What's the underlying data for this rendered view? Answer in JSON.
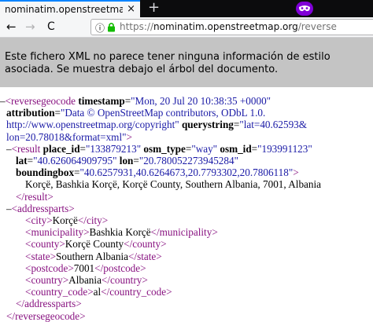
{
  "browser": {
    "tab_title": "nominatim.openstreetmap.org/revers",
    "close_glyph": "×",
    "newtab_glyph": "+",
    "back_glyph": "←",
    "forward_glyph": "→",
    "reload_glyph": "C",
    "info_glyph": "ⓘ",
    "url_scheme": "https://",
    "url_host": "nominatim.openstreetmap.org",
    "url_path": "/reverse"
  },
  "banner": {
    "message": "Este fichero XML no parece tener ninguna información de estilo asociada. Se muestra debajo el árbol del documento."
  },
  "xml": {
    "collapse": "–",
    "lt": "<",
    "gt": ">",
    "close_open": "</",
    "eq": "=",
    "root_tag": "reversegeocode",
    "attr_timestamp": "timestamp",
    "val_timestamp": "\"Mon, 20 Jul 20 10:38:35 +0000\"",
    "attr_attribution": "attribution",
    "val_attribution_1": "\"Data © OpenStreetMap contributors, ODbL 1.0.",
    "val_attribution_2": "http://www.openstreetmap.org/copyright\"",
    "attr_querystring": "querystring",
    "val_querystring_1": "\"lat=40.62593&",
    "val_querystring_2": "lon=20.78018&format=xml\"",
    "result_tag": "result",
    "attr_place_id": "place_id",
    "val_place_id": "\"133879213\"",
    "attr_osm_type": "osm_type",
    "val_osm_type": "\"way\"",
    "attr_osm_id": "osm_id",
    "val_osm_id": "\"193991123\"",
    "attr_lat": "lat",
    "val_lat": "\"40.626064909795\"",
    "attr_lon": "lon",
    "val_lon": "\"20.780052273945284\"",
    "attr_boundingbox": "boundingbox",
    "val_boundingbox": "\"40.6257931,40.6264673,20.7793302,20.7806118\"",
    "result_text": "Korçë, Bashkia Korçë, Korçë County, Southern Albania, 7001, Albania",
    "addressparts_tag": "addressparts",
    "address": [
      {
        "tag": "city",
        "value": "Korçë"
      },
      {
        "tag": "municipality",
        "value": "Bashkia Korçë"
      },
      {
        "tag": "county",
        "value": "Korçë County"
      },
      {
        "tag": "state",
        "value": "Southern Albania"
      },
      {
        "tag": "postcode",
        "value": "7001"
      },
      {
        "tag": "country",
        "value": "Albania"
      },
      {
        "tag": "country_code",
        "value": "al"
      }
    ]
  }
}
